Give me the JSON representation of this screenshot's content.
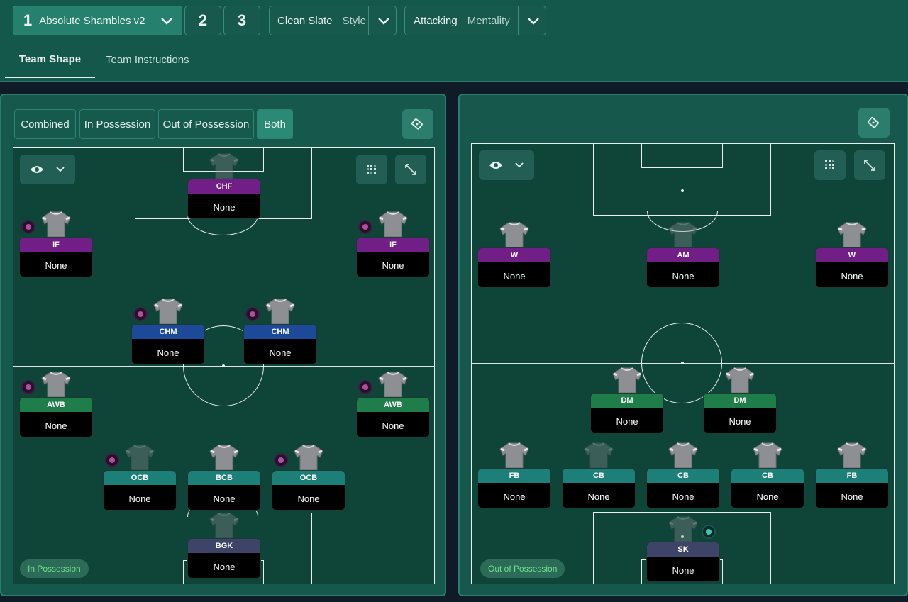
{
  "tactic": {
    "slot1_number": "1",
    "slot1_name": "Absolute Shambles v2",
    "slot2": "2",
    "slot3": "3"
  },
  "style": {
    "value": "Clean Slate",
    "label": "Style"
  },
  "mentality": {
    "value": "Attacking",
    "label": "Mentality"
  },
  "tabs": {
    "team_shape": "Team Shape",
    "team_instructions": "Team Instructions"
  },
  "filters": {
    "combined": "Combined",
    "in_possession": "In Possession",
    "out_of_possession": "Out of Possession",
    "both": "Both"
  },
  "left_panel": {
    "tag": "In Possession",
    "players": [
      {
        "role": "CHF",
        "duty": "None",
        "color": "purple"
      },
      {
        "role": "IF",
        "duty": "None",
        "color": "purple"
      },
      {
        "role": "IF",
        "duty": "None",
        "color": "purple"
      },
      {
        "role": "CHM",
        "duty": "None",
        "color": "blue"
      },
      {
        "role": "CHM",
        "duty": "None",
        "color": "blue"
      },
      {
        "role": "AWB",
        "duty": "None",
        "color": "green"
      },
      {
        "role": "AWB",
        "duty": "None",
        "color": "green"
      },
      {
        "role": "OCB",
        "duty": "None",
        "color": "teal"
      },
      {
        "role": "BCB",
        "duty": "None",
        "color": "teal"
      },
      {
        "role": "OCB",
        "duty": "None",
        "color": "teal"
      },
      {
        "role": "BGK",
        "duty": "None",
        "color": "slate"
      }
    ]
  },
  "right_panel": {
    "tag": "Out of Possession",
    "players": [
      {
        "role": "W",
        "duty": "None",
        "color": "purple"
      },
      {
        "role": "AM",
        "duty": "None",
        "color": "purple"
      },
      {
        "role": "W",
        "duty": "None",
        "color": "purple"
      },
      {
        "role": "DM",
        "duty": "None",
        "color": "green"
      },
      {
        "role": "DM",
        "duty": "None",
        "color": "green"
      },
      {
        "role": "FB",
        "duty": "None",
        "color": "teal"
      },
      {
        "role": "CB",
        "duty": "None",
        "color": "teal"
      },
      {
        "role": "CB",
        "duty": "None",
        "color": "teal"
      },
      {
        "role": "CB",
        "duty": "None",
        "color": "teal"
      },
      {
        "role": "FB",
        "duty": "None",
        "color": "teal"
      },
      {
        "role": "SK",
        "duty": "None",
        "color": "slate"
      }
    ]
  },
  "colors": {
    "purple": "#711f86",
    "blue": "#1c4a99",
    "green": "#1e7d48",
    "teal": "#1c8078",
    "slate": "#3e4468",
    "accent": "#2b8a75"
  }
}
